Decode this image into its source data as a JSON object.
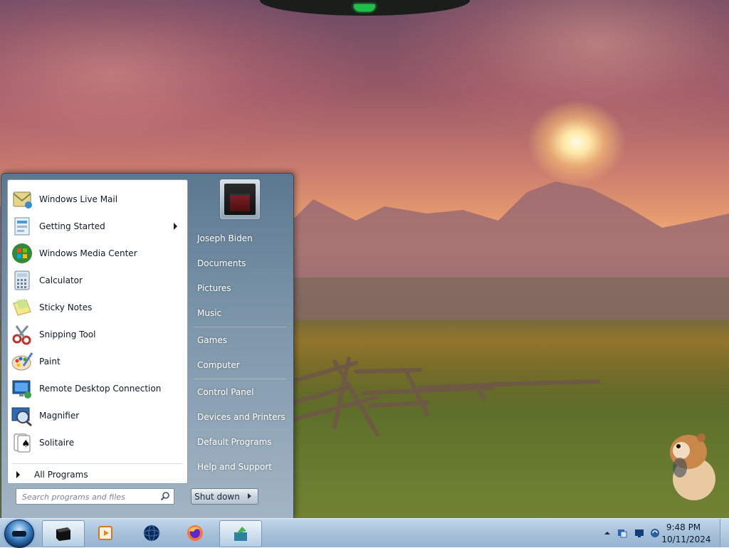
{
  "start_menu": {
    "programs": [
      {
        "label": "Windows Live Mail",
        "icon": "mail-icon",
        "has_submenu": false
      },
      {
        "label": "Getting Started",
        "icon": "getting-started-icon",
        "has_submenu": true
      },
      {
        "label": "Windows Media Center",
        "icon": "media-center-icon",
        "has_submenu": false
      },
      {
        "label": "Calculator",
        "icon": "calculator-icon",
        "has_submenu": false
      },
      {
        "label": "Sticky Notes",
        "icon": "sticky-notes-icon",
        "has_submenu": false
      },
      {
        "label": "Snipping Tool",
        "icon": "scissors-icon",
        "has_submenu": false
      },
      {
        "label": "Paint",
        "icon": "paint-palette-icon",
        "has_submenu": false
      },
      {
        "label": "Remote Desktop Connection",
        "icon": "remote-desktop-icon",
        "has_submenu": false
      },
      {
        "label": "Magnifier",
        "icon": "magnifier-icon",
        "has_submenu": false
      },
      {
        "label": "Solitaire",
        "icon": "cards-icon",
        "has_submenu": false
      }
    ],
    "all_programs": "All Programs",
    "search_placeholder": "Search programs and files",
    "right_items": [
      {
        "label": "Joseph Biden"
      },
      {
        "label": "Documents"
      },
      {
        "label": "Pictures"
      },
      {
        "label": "Music"
      },
      {
        "label": "Games"
      },
      {
        "label": "Computer"
      },
      {
        "label": "Control Panel"
      },
      {
        "label": "Devices and Printers"
      },
      {
        "label": "Default Programs"
      },
      {
        "label": "Help and Support"
      }
    ],
    "shutdown_label": "Shut down"
  },
  "taskbar": {
    "pinned": [
      {
        "name": "terminal",
        "icon": "black-window-icon",
        "active": true
      },
      {
        "name": "media-player",
        "icon": "media-player-icon",
        "active": false
      },
      {
        "name": "globe",
        "icon": "globe-icon",
        "active": false
      },
      {
        "name": "firefox",
        "icon": "firefox-icon",
        "active": false
      },
      {
        "name": "app",
        "icon": "green-arrow-icon",
        "active": true
      }
    ],
    "tray": {
      "icons": [
        "show-hidden-icons-chevron",
        "network-icon",
        "monitor-icon",
        "volume-icon"
      ],
      "time": "9:48 PM",
      "date": "10/11/2024"
    }
  },
  "colors": {
    "taskbar": "#a7c1da",
    "start_menu_right_pane": "#7e97ab",
    "start_menu_left_pane": "#ffffff"
  }
}
